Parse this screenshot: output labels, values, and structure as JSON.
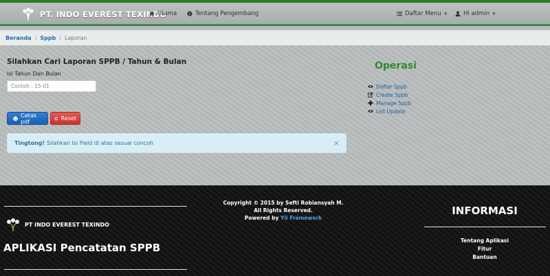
{
  "navbar": {
    "brand": "PT. INDO EVEREST TEXINDO",
    "items": [
      {
        "label": "Utama",
        "icon": "home-icon"
      },
      {
        "label": "Tentang Pengembang",
        "icon": "info-icon"
      }
    ],
    "right": [
      {
        "label": "Daftar Menu",
        "icon": "list-icon"
      },
      {
        "label": "Hi admin",
        "icon": "user-icon"
      }
    ]
  },
  "breadcrumb": {
    "items": [
      "Beranda",
      "Sppb"
    ],
    "active": "Laporan"
  },
  "form": {
    "heading": "Silahkan Cari Laporan SPPB / Tahun & Bulan",
    "label": "Isi Tahun Dan Bulan",
    "placeholder": "Contoh : 15-01",
    "value": "",
    "print_label": "Cetak pdf",
    "reset_label": "Reset"
  },
  "alert": {
    "strong": "Tingtong!",
    "text": "Silahkan Isi Field di atas sesuai concoh",
    "close": "×"
  },
  "operasi": {
    "title": "Operasi",
    "items": [
      {
        "label": "Daftar Sppb",
        "icon": "eye-icon"
      },
      {
        "label": "Create Sppb",
        "icon": "edit-icon"
      },
      {
        "label": "Manage Sppb",
        "icon": "gear-icon"
      },
      {
        "label": "List Update",
        "icon": "eye-icon"
      }
    ]
  },
  "footer": {
    "brand": "PT INDO EVEREST TEXINDO",
    "app_title": "APLIKASI Pencatatan SPPB",
    "copyright": "Copyright © 2015 by Sefti Robiansyah M.",
    "rights": "All Rights Reserved.",
    "powered_prefix": "Powered by",
    "powered_link": "Yii Framework",
    "info_title": "INFORMASI",
    "links": [
      "Tentang Aplikasi",
      "Fitur",
      "Bantuan"
    ]
  },
  "colors": {
    "accent_green": "#2e8a2e",
    "link_blue": "#1f5f9f",
    "primary": "#1a5fae",
    "danger": "#c4332d"
  }
}
